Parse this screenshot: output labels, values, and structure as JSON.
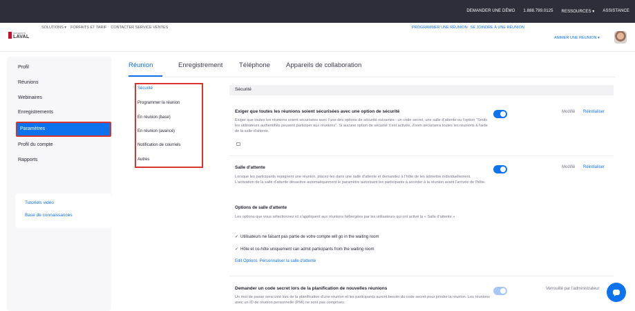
{
  "topbar": {
    "links": [
      "DEMANDER UNE DÉMO",
      "1.888.799.0125",
      "RESSOURCES ▾",
      "ASSISTANCE"
    ]
  },
  "header": {
    "logo_small": "UNIVERSITÉ",
    "logo_big": "LAVAL",
    "nav": [
      "SOLUTIONS ▾",
      "FORFAITS ET TARIF",
      "CONTACTER SERVICE VENTES"
    ],
    "schedule": "PROGRAMMER UNE RÉUNION",
    "join": "SE JOINDRE À UNE RÉUNION",
    "host": "ANIMER UNE RÉUNION ▾"
  },
  "sidebar": {
    "items": [
      "Profil",
      "Réunions",
      "Webinaires",
      "Enregistrements",
      "Paramètres",
      "Profil du compte",
      "Rapports"
    ],
    "help": [
      "Tutoriels vidéo",
      "Base de connaissances"
    ]
  },
  "tabs": [
    "Réunion",
    "Enregistrement",
    "Téléphone",
    "Appareils de collaboration"
  ],
  "submenu": [
    "Sécurité",
    "Programmer la réunion",
    "En réunion (base)",
    "En réunion (avancé)",
    "Notification de courriels",
    "Autres"
  ],
  "section_title": "Sécurité",
  "settings": {
    "s1": {
      "title": "Exiger que toutes les réunions soient sécurisées avec une option de sécurité",
      "desc": "Exiger que toutes les réunions soient sécurisées avec l'une des options de sécurité suivantes : un code secret, une salle d'attente ou l'option \"Seuls les utilisateurs authentifiés peuvent participer aux réunions\". Si aucune option de sécurité n'est activée, Zoom sécurisera toutes les réunions à l'aide de la salle d'attente.",
      "status": "Modifié",
      "reset": "Réinitialiser"
    },
    "s2": {
      "title": "Salle d'attente",
      "desc": "Lorsque les participants rejoignent une réunion, placez-les dans une salle d'attente et demandez à l'hôte de les admettre individuellement. L'activation de la salle d'attente désactive automatiquement le paramètre autorisant les participants à accéder à la réunion avant l'arrivée de l'hôte.",
      "status": "Modifié",
      "reset": "Réinitialiser",
      "options_title": "Options de salle d'attente",
      "options_desc": "Les options que vous sélectionnez ici s'appliquent aux réunions hébergées par les utilisateurs qui ont activé la « Salle d'attente »",
      "check1": "Utilisateurs ne faisant pas partie de votre compte will go in the waiting room",
      "check2": "Hôte et co-hôte uniquement can admit participants from the waiting room",
      "edit_options": "Edit Options",
      "customize": "Personnaliser la salle d'attente"
    },
    "s3": {
      "title": "Demander un code secret lors de la planification de nouvelles réunions",
      "desc": "Un mot de passe sera créé lors de la planification d'une réunion et les participants auront besoin du code secret pour joindre la réunion. Les réunions avec un ID de réunion personnelle (PMI) ne sont pas comprises.",
      "status": "Verrouillé par l'administrateur"
    }
  },
  "colors": {
    "accent": "#0e72ed",
    "highlight_border": "#d9342b",
    "topbar": "#2d2e3a"
  }
}
